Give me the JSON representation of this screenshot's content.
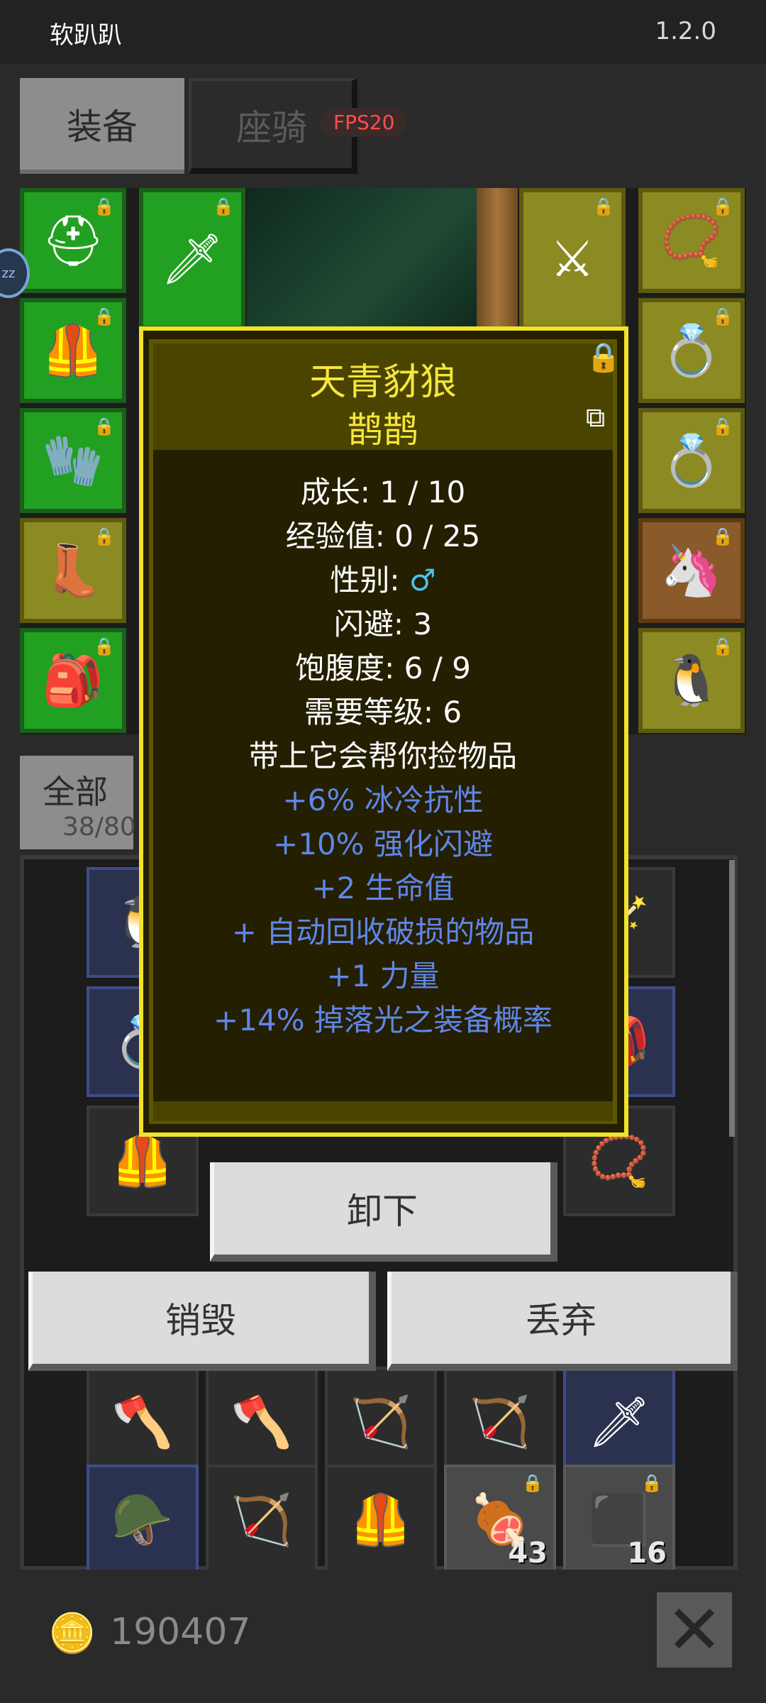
{
  "app": {
    "name": "软趴趴",
    "version": "1.2.0"
  },
  "tabs": {
    "equip": "装备",
    "mount": "座骑",
    "fps": "FPS20"
  },
  "inventory": {
    "tab_label": "全部",
    "tab_count": "38/80",
    "qty_a": "43",
    "qty_b": "16"
  },
  "popup": {
    "title": "天青豺狼",
    "subtitle": "鹊鹊",
    "stats": {
      "growth": "成长: 1 / 10",
      "exp": "经验值: 0 / 25",
      "gender_label": "性别:",
      "gender_symbol": "♂",
      "dodge": "闪避: 3",
      "satiety": "饱腹度: 6 / 9",
      "level": "需要等级: 6",
      "desc": "带上它会帮你捡物品"
    },
    "bonuses": [
      "+6% 冰冷抗性",
      "+10% 强化闪避",
      "+2 生命值",
      "+ 自动回收破损的物品",
      "+1 力量",
      "+14% 掉落光之装备概率"
    ]
  },
  "actions": {
    "unequip": "卸下",
    "destroy": "销毁",
    "discard": "丢弃"
  },
  "footer": {
    "gold": "190407"
  },
  "icons": {
    "lock": "lock-icon",
    "share": "share-icon",
    "close": "close-icon",
    "coin": "coin-icon"
  },
  "colors": {
    "popup_border": "#f1e22a",
    "title": "#f5e63a",
    "bonus": "#5f86e8",
    "gender": "#4ec1e8"
  }
}
